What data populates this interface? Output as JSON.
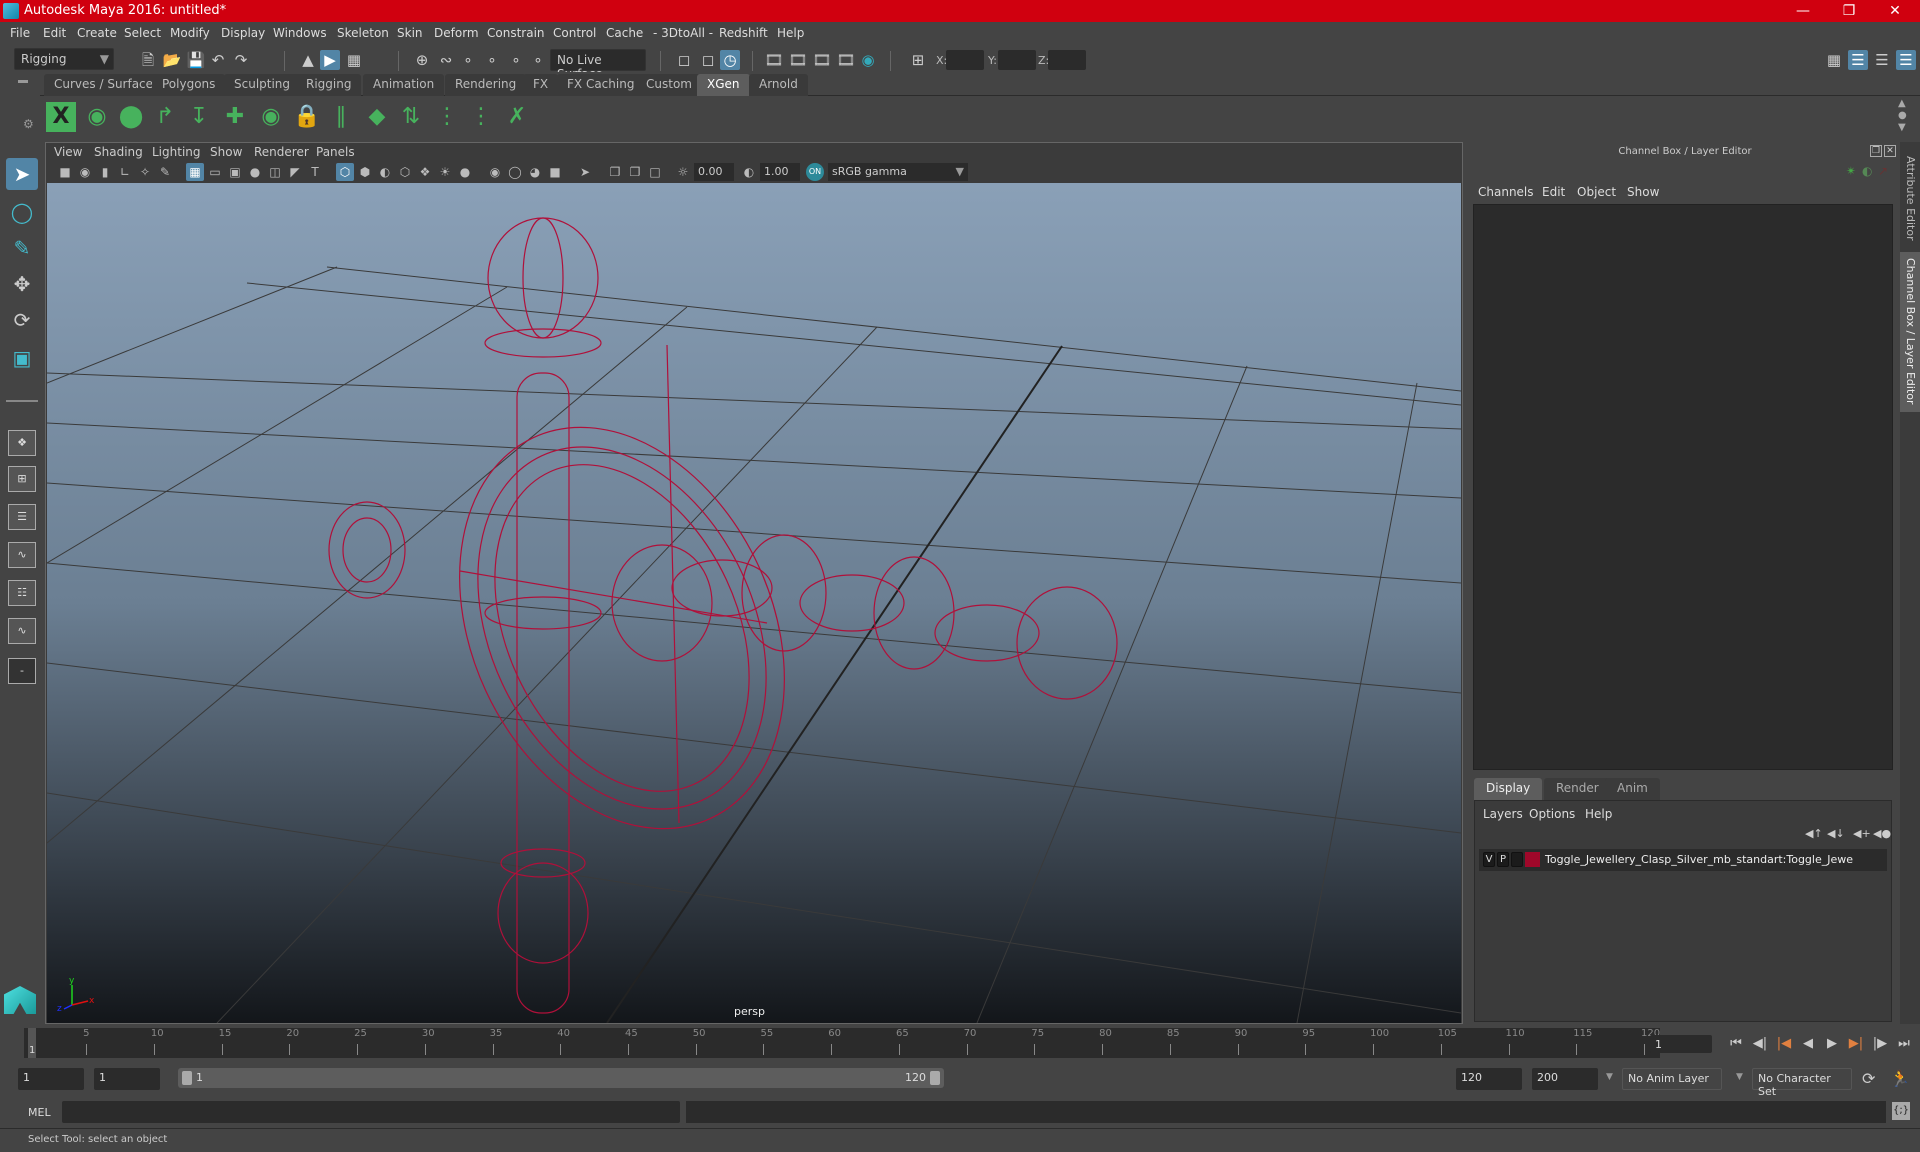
{
  "window": {
    "title": "Autodesk Maya 2016: untitled*",
    "controls": [
      "minimize",
      "restore",
      "close"
    ]
  },
  "menubar": [
    "File",
    "Edit",
    "Create",
    "Select",
    "Modify",
    "Display",
    "Windows",
    "Skeleton",
    "Skin",
    "Deform",
    "Constrain",
    "Control",
    "Cache",
    "- 3DtoAll -",
    "Redshift",
    "Help"
  ],
  "statusline": {
    "menuset": "Rigging",
    "live_surface": "No Live Surface",
    "xyz": {
      "x_label": "X:",
      "y_label": "Y:",
      "z_label": "Z:",
      "x": "",
      "y": "",
      "z": ""
    }
  },
  "shelf": {
    "tabs": [
      "Curves / Surfaces",
      "Polygons",
      "Sculpting",
      "Rigging",
      "Animation",
      "Rendering",
      "FX",
      "FX Caching",
      "Custom",
      "XGen",
      "Arnold"
    ],
    "active_tab": "XGen",
    "icons": [
      "xgen-window-icon",
      "xgen-preview-icon",
      "xgen-clear-preview-icon",
      "xgen-add-guide-icon",
      "xgen-sculpt-guide-icon",
      "xgen-insert-cv-icon",
      "xgen-select-cv-icon",
      "xgen-lock-icon",
      "xgen-guide-icon",
      "xgen-patch-icon",
      "xgen-flip-icon",
      "xgen-select-guide-icon",
      "xgen-convert-guide-icon",
      "xgen-delete-guide-icon"
    ]
  },
  "toolbox": {
    "tools": [
      "select-tool",
      "lasso-tool",
      "paint-select-tool",
      "move-tool",
      "rotate-tool",
      "scale-tool"
    ],
    "active_tool": "select-tool"
  },
  "viewport": {
    "menus": [
      "View",
      "Shading",
      "Lighting",
      "Show",
      "Renderer",
      "Panels"
    ],
    "exposure": "0.00",
    "gamma": "1.00",
    "color_space": "sRGB gamma",
    "camera": "persp",
    "axis": {
      "x": "x",
      "y": "y",
      "z": "z"
    },
    "wire_color": "#b0103a"
  },
  "channel_box": {
    "title": "Channel Box / Layer Editor",
    "menus": [
      "Channels",
      "Edit",
      "Object",
      "Show"
    ],
    "layer_tabs": [
      "Display",
      "Render",
      "Anim"
    ],
    "active_layer_tab": "Display",
    "layer_menus": [
      "Layers",
      "Options",
      "Help"
    ],
    "layers": [
      {
        "v": "V",
        "p": "P",
        "color": "#a0082a",
        "name": "Toggle_Jewellery_Clasp_Silver_mb_standart:Toggle_Jewe"
      }
    ]
  },
  "side_tabs": [
    "Attribute Editor",
    "Channel Box / Layer Editor"
  ],
  "timeline": {
    "ticks": [
      "5",
      "10",
      "15",
      "20",
      "25",
      "30",
      "35",
      "40",
      "45",
      "50",
      "55",
      "60",
      "65",
      "70",
      "75",
      "80",
      "85",
      "90",
      "95",
      "100",
      "105",
      "110",
      "115",
      "120"
    ],
    "current_frame_marker": "1",
    "current_frame": "1",
    "range_start": "1",
    "playback_start": "1",
    "slider_start": "1",
    "slider_end": "120",
    "playback_end": "120",
    "range_end": "200",
    "anim_layer": "No Anim Layer",
    "character_set": "No Character Set"
  },
  "command_line": {
    "label": "MEL",
    "value": "",
    "result": ""
  },
  "help_line": "Select Tool: select an object"
}
